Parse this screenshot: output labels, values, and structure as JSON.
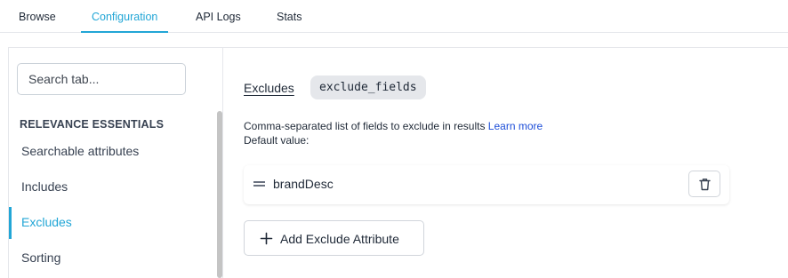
{
  "tabs": [
    {
      "label": "Browse",
      "active": false
    },
    {
      "label": "Configuration",
      "active": true
    },
    {
      "label": "API Logs",
      "active": false
    },
    {
      "label": "Stats",
      "active": false
    }
  ],
  "sidebar": {
    "search_placeholder": "Search tab...",
    "section_title": "RELEVANCE ESSENTIALS",
    "items": [
      {
        "label": "Searchable attributes",
        "active": false
      },
      {
        "label": "Includes",
        "active": false
      },
      {
        "label": "Excludes",
        "active": true
      },
      {
        "label": "Sorting",
        "active": false
      }
    ]
  },
  "main": {
    "setting_label": "Excludes",
    "param_name": "exclude_fields",
    "description": "Comma-separated list of fields to exclude in results",
    "learn_more": "Learn more",
    "default_value": "Default value:",
    "attributes": [
      {
        "name": "brandDesc",
        "drag_icon": "drag-handle-icon",
        "delete_icon": "trash-icon"
      }
    ],
    "add_button_label": "Add Exclude Attribute",
    "add_icon": "plus-icon"
  },
  "colors": {
    "accent": "#22a6d6",
    "link": "#1d4ed8",
    "chip_bg": "#e5e7eb",
    "border": "#e5e7eb"
  }
}
